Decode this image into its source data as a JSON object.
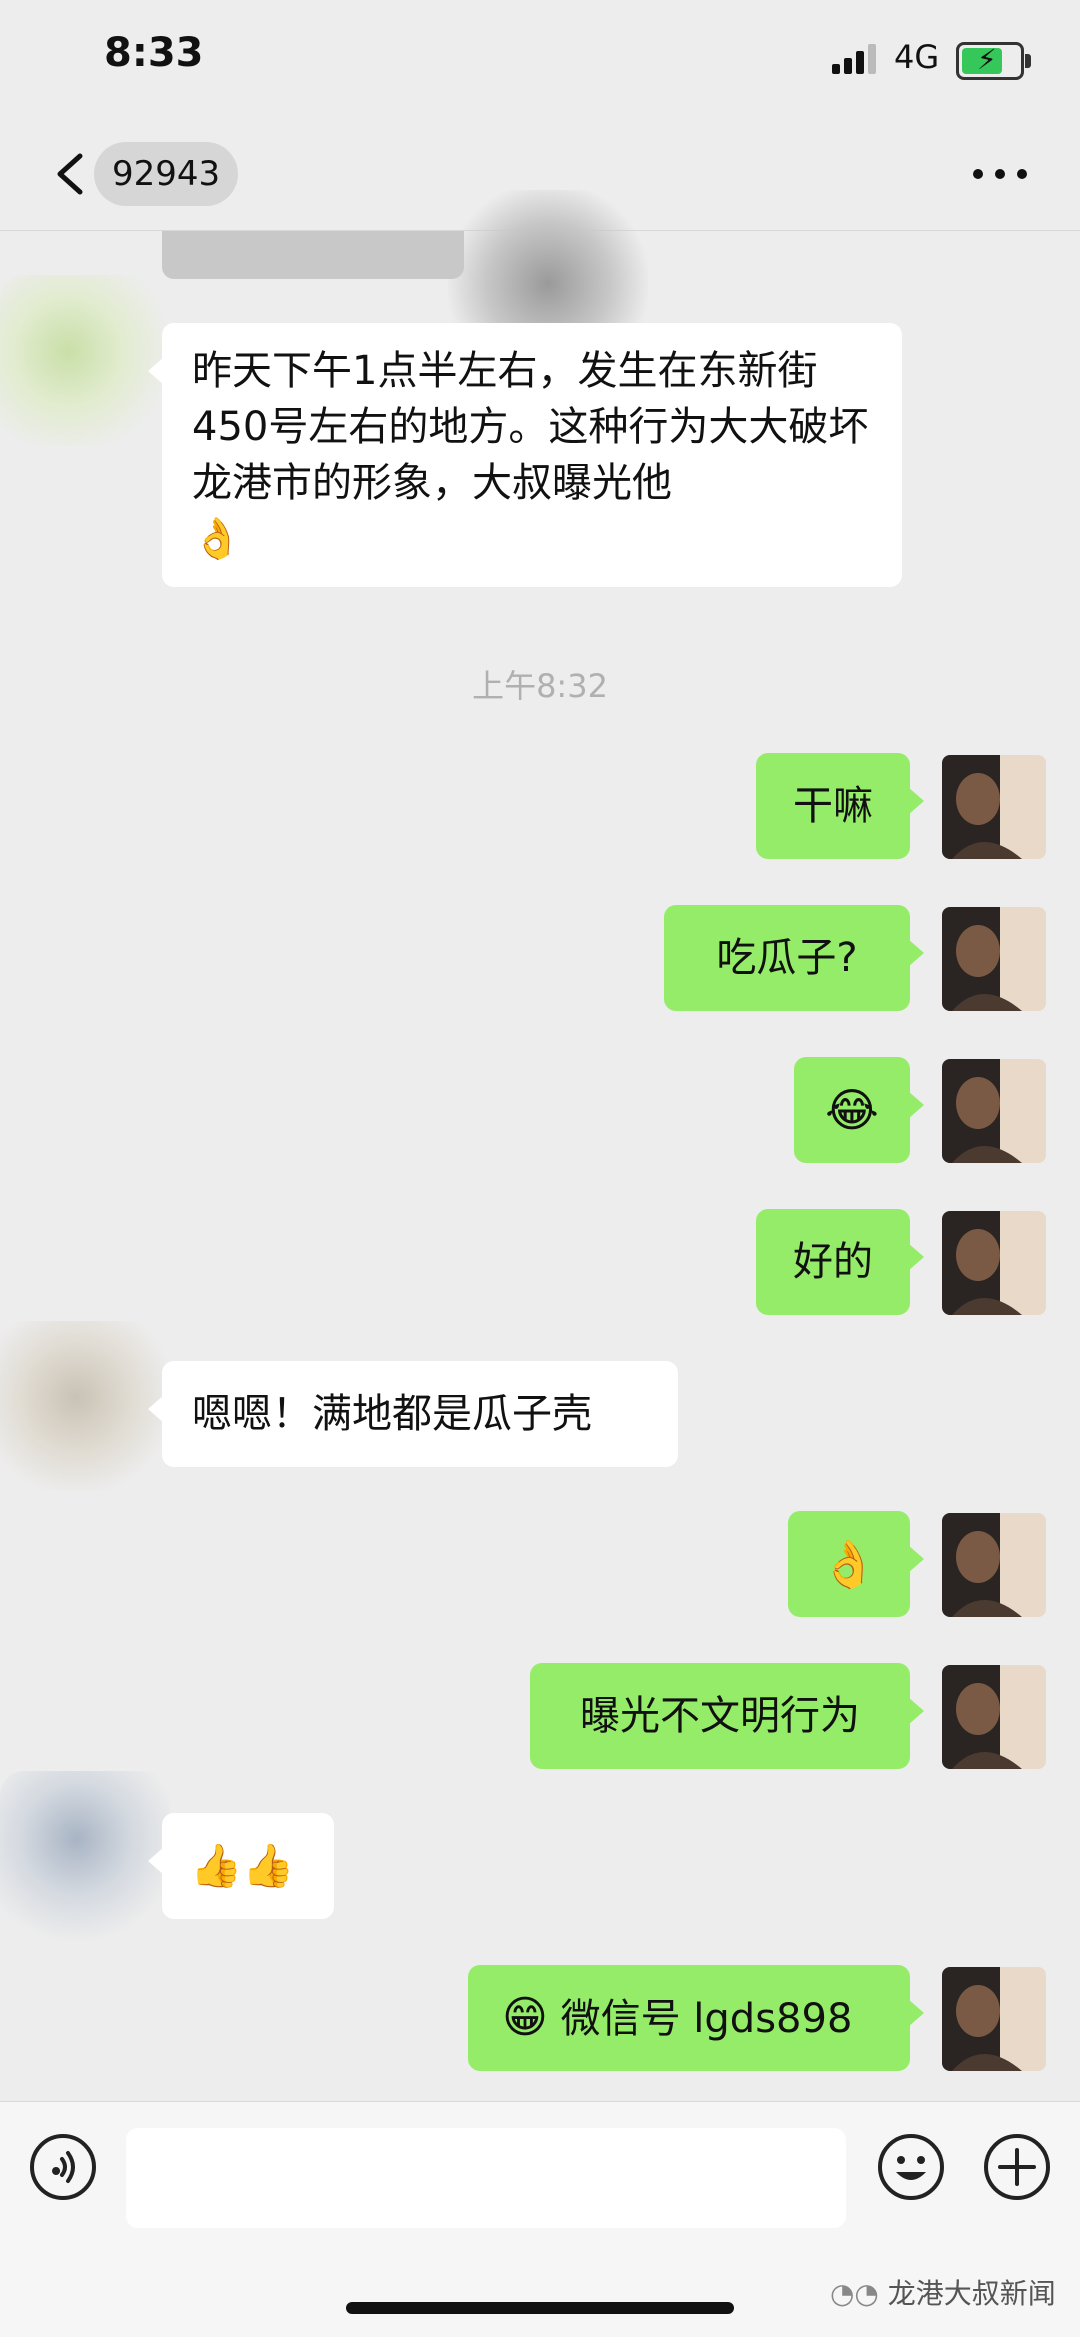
{
  "status_bar": {
    "time": "8:33",
    "network": "4G"
  },
  "header": {
    "contact_name": "92943"
  },
  "messages": {
    "m1": {
      "text": "昨天下午1点半左右，发生在东新街450号左右的地方。这种行为大大破坏龙港市的形象，大叔曝光他"
    },
    "timestamp": "上午8:32",
    "m2": {
      "text": "干嘛"
    },
    "m3": {
      "text": "吃瓜子?"
    },
    "m5": {
      "text": "好的"
    },
    "m6": {
      "text": "嗯嗯！满地都是瓜子壳"
    },
    "m8": {
      "text": "曝光不文明行为"
    },
    "m10": {
      "text": "微信号 lgds898"
    }
  },
  "icons": {
    "back": "chevron-left-icon",
    "more": "more-dots-icon",
    "voice": "voice-icon",
    "emoji": "emoji-icon",
    "plus": "plus-icon"
  },
  "colors": {
    "background": "#ededed",
    "sent_bubble": "#95ec69",
    "received_bubble": "#ffffff"
  },
  "watermark": "龙港大叔新闻"
}
